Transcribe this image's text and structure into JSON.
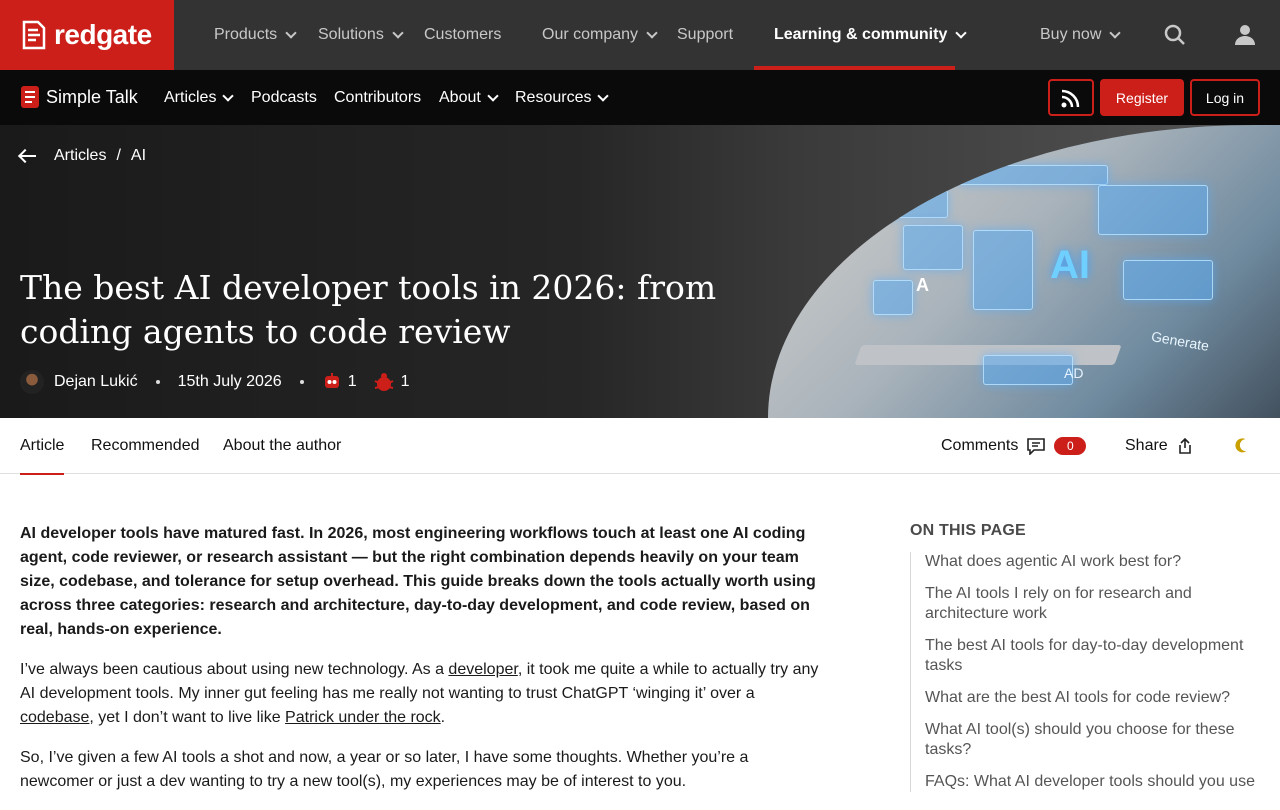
{
  "topnav": {
    "brand": "redgate",
    "items": [
      {
        "label": "Products",
        "dropdown": true
      },
      {
        "label": "Solutions",
        "dropdown": true
      },
      {
        "label": "Customers",
        "dropdown": false
      },
      {
        "label": "Our company",
        "dropdown": true
      },
      {
        "label": "Support",
        "dropdown": false
      },
      {
        "label": "Learning & community",
        "dropdown": true,
        "active": true
      },
      {
        "label": "Buy now",
        "dropdown": true
      }
    ],
    "icons": [
      "search-icon",
      "user-icon"
    ]
  },
  "subnav": {
    "brand": "Simple Talk",
    "items": [
      {
        "label": "Articles",
        "dropdown": true
      },
      {
        "label": "Podcasts",
        "dropdown": false
      },
      {
        "label": "Contributors",
        "dropdown": false
      },
      {
        "label": "About",
        "dropdown": true
      },
      {
        "label": "Resources",
        "dropdown": true
      }
    ],
    "register_label": "Register",
    "login_label": "Log in"
  },
  "hero": {
    "breadcrumb": [
      "Articles",
      "/",
      "AI"
    ],
    "title": "The best AI developer tools in 2026: from coding agents to code review",
    "author": "Dejan Lukić",
    "date": "15th July 2026",
    "reaction_1_count": "1",
    "reaction_2_count": "1",
    "image_text": {
      "ai": "AI",
      "a": "A",
      "generate": "Generate",
      "ad": "AD"
    }
  },
  "tabs": {
    "article": "Article",
    "recommended": "Recommended",
    "about_author": "About the author",
    "comments": "Comments",
    "comments_count": "0",
    "share": "Share"
  },
  "article": {
    "lead": "AI developer tools have matured fast. In 2026, most engineering workflows touch at least one AI coding agent, code reviewer, or research assistant — but the right combination depends heavily on your team size, codebase, and tolerance for setup overhead. This guide breaks down the tools actually worth using across three categories: research and architecture, day-to-day development, and code review, based on real, hands-on experience.",
    "p2_a": "I’ve always been cautious about using new technology. As a ",
    "p2_link1": "developer",
    "p2_b": ", it took me quite a while to actually try any AI development tools. My inner gut feeling has me really not wanting to trust ChatGPT ‘winging it’ over a ",
    "p2_link2": "codebase",
    "p2_c": ", yet I don’t want to live like ",
    "p2_link3": "Patrick under the rock",
    "p2_d": ".",
    "p3": "So, I’ve given a few AI tools a shot and now, a year or so later, I have some thoughts. Whether you’re a newcomer or just a dev wanting to try a new tool(s), my experiences may be of interest to you."
  },
  "toc": {
    "heading": "ON THIS PAGE",
    "items": [
      "What does agentic AI work best for?",
      "The AI tools I rely on for research and architecture work",
      "The best AI tools for day-to-day development tasks",
      "What are the best AI tools for code review?",
      "What AI tool(s) should you choose for these tasks?",
      "FAQs: What AI developer tools should you use"
    ]
  },
  "colors": {
    "brand_red": "#cc1f1a",
    "topnav_bg": "#333333",
    "subnav_bg": "#0a0a0a"
  }
}
